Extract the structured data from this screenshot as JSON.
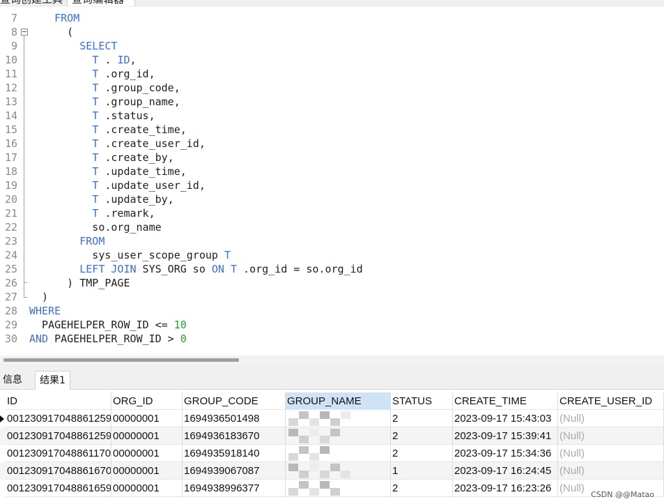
{
  "top_tabs": [
    "查询创建工具",
    "查询编辑器"
  ],
  "editor": {
    "lines": [
      {
        "n": "7",
        "tokens": [
          {
            "t": "    "
          },
          {
            "t": "FROM",
            "k": "kw"
          }
        ]
      },
      {
        "n": "8",
        "fold": "box",
        "tokens": [
          {
            "t": "      ("
          }
        ]
      },
      {
        "n": "9",
        "tokens": [
          {
            "t": "        "
          },
          {
            "t": "SELECT",
            "k": "kw"
          }
        ]
      },
      {
        "n": "10",
        "tokens": [
          {
            "t": "          "
          },
          {
            "t": "T",
            "k": "kw"
          },
          {
            "t": " . "
          },
          {
            "t": "ID",
            "k": "kw"
          },
          {
            "t": ","
          }
        ]
      },
      {
        "n": "11",
        "tokens": [
          {
            "t": "          "
          },
          {
            "t": "T",
            "k": "kw"
          },
          {
            "t": " .org_id,"
          }
        ]
      },
      {
        "n": "12",
        "tokens": [
          {
            "t": "          "
          },
          {
            "t": "T",
            "k": "kw"
          },
          {
            "t": " .group_code,"
          }
        ]
      },
      {
        "n": "13",
        "tokens": [
          {
            "t": "          "
          },
          {
            "t": "T",
            "k": "kw"
          },
          {
            "t": " .group_name,"
          }
        ]
      },
      {
        "n": "14",
        "tokens": [
          {
            "t": "          "
          },
          {
            "t": "T",
            "k": "kw"
          },
          {
            "t": " .status,"
          }
        ]
      },
      {
        "n": "15",
        "tokens": [
          {
            "t": "          "
          },
          {
            "t": "T",
            "k": "kw"
          },
          {
            "t": " .create_time,"
          }
        ]
      },
      {
        "n": "16",
        "tokens": [
          {
            "t": "          "
          },
          {
            "t": "T",
            "k": "kw"
          },
          {
            "t": " .create_user_id,"
          }
        ]
      },
      {
        "n": "17",
        "tokens": [
          {
            "t": "          "
          },
          {
            "t": "T",
            "k": "kw"
          },
          {
            "t": " .create_by,"
          }
        ]
      },
      {
        "n": "18",
        "tokens": [
          {
            "t": "          "
          },
          {
            "t": "T",
            "k": "kw"
          },
          {
            "t": " .update_time,"
          }
        ]
      },
      {
        "n": "19",
        "tokens": [
          {
            "t": "          "
          },
          {
            "t": "T",
            "k": "kw"
          },
          {
            "t": " .update_user_id,"
          }
        ]
      },
      {
        "n": "20",
        "tokens": [
          {
            "t": "          "
          },
          {
            "t": "T",
            "k": "kw"
          },
          {
            "t": " .update_by,"
          }
        ]
      },
      {
        "n": "21",
        "tokens": [
          {
            "t": "          "
          },
          {
            "t": "T",
            "k": "kw"
          },
          {
            "t": " .remark,"
          }
        ]
      },
      {
        "n": "22",
        "tokens": [
          {
            "t": "          so.org_name"
          }
        ]
      },
      {
        "n": "23",
        "tokens": [
          {
            "t": "        "
          },
          {
            "t": "FROM",
            "k": "kw"
          }
        ]
      },
      {
        "n": "24",
        "tokens": [
          {
            "t": "          sys_user_scope_group "
          },
          {
            "t": "T",
            "k": "kw"
          }
        ]
      },
      {
        "n": "25",
        "tokens": [
          {
            "t": "        "
          },
          {
            "t": "LEFT",
            "k": "kw"
          },
          {
            "t": " "
          },
          {
            "t": "JOIN",
            "k": "kw"
          },
          {
            "t": " SYS_ORG so "
          },
          {
            "t": "ON",
            "k": "kw"
          },
          {
            "t": " "
          },
          {
            "t": "T",
            "k": "kw"
          },
          {
            "t": " .org_id = so.org_id"
          }
        ]
      },
      {
        "n": "26",
        "fold": "tick",
        "tokens": [
          {
            "t": "      ) TMP_PAGE"
          }
        ]
      },
      {
        "n": "27",
        "fold": "end",
        "tokens": [
          {
            "t": "  )"
          }
        ]
      },
      {
        "n": "28",
        "tokens": [
          {
            "t": "WHERE",
            "k": "kw"
          }
        ]
      },
      {
        "n": "29",
        "tokens": [
          {
            "t": "  PAGEHELPER_ROW_ID <= "
          },
          {
            "t": "10",
            "k": "num"
          }
        ]
      },
      {
        "n": "30",
        "tokens": [
          {
            "t": "AND",
            "k": "kw"
          },
          {
            "t": " PAGEHELPER_ROW_ID > "
          },
          {
            "t": "0",
            "k": "num"
          }
        ]
      }
    ]
  },
  "result_tabs": {
    "info": "信息",
    "result": "结果1"
  },
  "table": {
    "columns": [
      "ID",
      "ORG_ID",
      "GROUP_CODE",
      "GROUP_NAME",
      "STATUS",
      "CREATE_TIME",
      "CREATE_USER_ID"
    ],
    "selected_column": "GROUP_NAME",
    "rows": [
      [
        "001230917048861259",
        "00000001",
        "1694936501498",
        "",
        "2",
        "2023-09-17 15:43:03",
        "(Null)"
      ],
      [
        "001230917048861259",
        "00000001",
        "1694936183670",
        "",
        "2",
        "2023-09-17 15:39:41",
        "(Null)"
      ],
      [
        "001230917048861170",
        "00000001",
        "1694935918140",
        "",
        "2",
        "2023-09-17 15:34:36",
        "(Null)"
      ],
      [
        "001230917048861670",
        "00000001",
        "1694939067087",
        "",
        "1",
        "2023-09-17 16:24:45",
        "(Null)"
      ],
      [
        "001230917048861659",
        "00000001",
        "1694938996377",
        "",
        "2",
        "2023-09-17 16:23:26",
        "(Null)"
      ]
    ]
  },
  "watermark": "CSDN @@Matao"
}
